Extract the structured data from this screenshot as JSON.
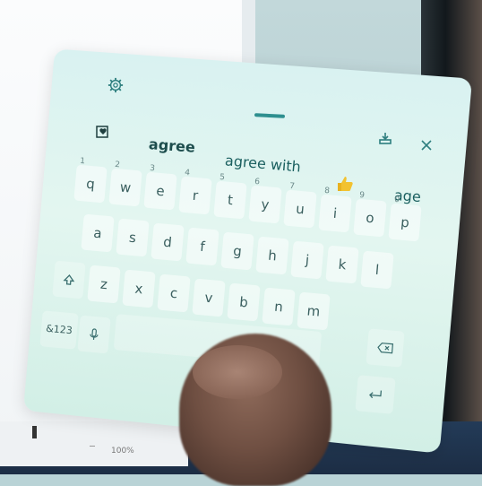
{
  "suggestions": [
    "agree",
    "agree with",
    "age"
  ],
  "keys": {
    "row1": [
      {
        "label": "q",
        "num": "1"
      },
      {
        "label": "w",
        "num": "2"
      },
      {
        "label": "e",
        "num": "3"
      },
      {
        "label": "r",
        "num": "4"
      },
      {
        "label": "t",
        "num": "5"
      },
      {
        "label": "y",
        "num": "6"
      },
      {
        "label": "u",
        "num": "7"
      },
      {
        "label": "i",
        "num": "8"
      },
      {
        "label": "o",
        "num": "9"
      },
      {
        "label": "p",
        "num": "0"
      }
    ],
    "row2": [
      "a",
      "s",
      "d",
      "f",
      "g",
      "h",
      "j",
      "k",
      "l"
    ],
    "row3": [
      "z",
      "x",
      "c",
      "v",
      "b",
      "n",
      "m"
    ],
    "numbers_label": "&123"
  },
  "statusbar": {
    "zoom": "100%"
  },
  "icons": [
    "gear-icon",
    "clipboard-icon",
    "dock-icon",
    "close-icon",
    "thumbs-up-emoji-icon",
    "shift-icon",
    "mic-icon",
    "backspace-icon",
    "enter-icon"
  ],
  "colors": {
    "keyboard_bg": "#d9f2f1",
    "accent": "#2e8f8f",
    "key_text": "#3a5f5f"
  }
}
